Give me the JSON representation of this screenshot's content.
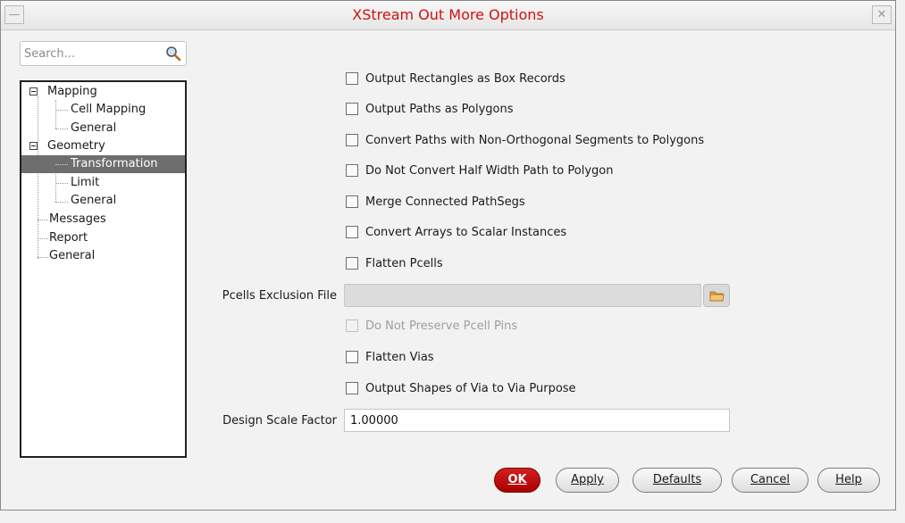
{
  "window": {
    "title": "XStream Out More Options",
    "menu_glyph": "—",
    "close_glyph": "✕"
  },
  "search": {
    "placeholder": "Search..."
  },
  "tree": {
    "mapping": "Mapping",
    "cell_mapping": "Cell Mapping",
    "mapping_general": "General",
    "geometry": "Geometry",
    "transformation": "Transformation",
    "limit": "Limit",
    "geometry_general": "General",
    "messages": "Messages",
    "report": "Report",
    "general": "General"
  },
  "options": {
    "rect_box": "Output Rectangles as Box Records",
    "paths_polygons": "Output Paths as Polygons",
    "nonortho": "Convert Paths with Non-Orthogonal Segments to Polygons",
    "half_width": "Do Not Convert Half Width Path to Polygon",
    "merge_pathsegs": "Merge Connected PathSegs",
    "arrays_scalar": "Convert Arrays to Scalar Instances",
    "flatten_pcells": "Flatten Pcells",
    "preserve_pins": "Do Not Preserve Pcell Pins",
    "flatten_vias": "Flatten Vias",
    "via_purpose": "Output Shapes of Via to Via Purpose"
  },
  "fields": {
    "pcells_exclusion_label": "Pcells Exclusion File",
    "pcells_exclusion_value": "",
    "scale_label": "Design Scale Factor",
    "scale_value": "1.00000"
  },
  "buttons": {
    "ok": "OK",
    "apply": "Apply",
    "defaults": "Defaults",
    "cancel": "Cancel",
    "help": "Help"
  },
  "colors": {
    "title": "#d01010",
    "ok_button": "#c01010",
    "selection": "#6e6e6e"
  }
}
